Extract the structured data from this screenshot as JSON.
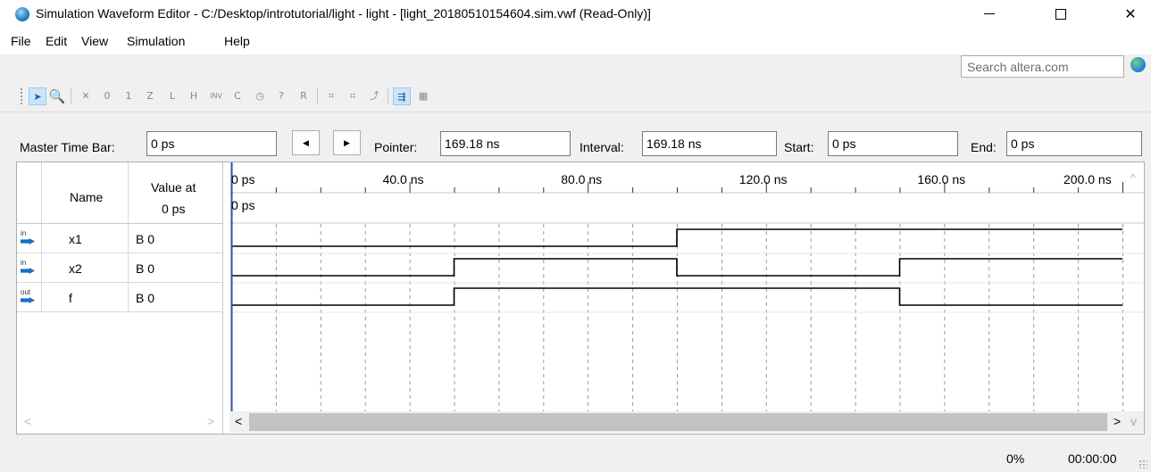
{
  "window": {
    "title": "Simulation Waveform Editor - C:/Desktop/introtutorial/light - light - [light_20180510154604.sim.vwf (Read-Only)]",
    "controls": {
      "minimize": "—",
      "maximize": "☐",
      "close": "✕"
    }
  },
  "menu": [
    "File",
    "Edit",
    "View",
    "Simulation",
    "Help"
  ],
  "search": {
    "placeholder": "Search altera.com"
  },
  "toolbar": {
    "tools": [
      "selection-tool",
      "zoom-tool",
      "forcing-unknown",
      "forcing-low",
      "forcing-high",
      "high-impedance",
      "weak-low",
      "weak-high",
      "invert",
      "count-value",
      "clock",
      "arbitrary-value",
      "random-value",
      "snap-to-grid",
      "grid-settings",
      "overwrite-clock",
      "overwrite-count",
      "snap-transitions",
      "waveform-settings"
    ]
  },
  "timebar": {
    "master_label": "Master Time Bar:",
    "master_value": "0 ps",
    "prev": "◀",
    "next": "▶",
    "pointer_label": "Pointer:",
    "pointer_value": "169.18 ns",
    "interval_label": "Interval:",
    "interval_value": "169.18 ns",
    "start_label": "Start:",
    "start_value": "0 ps",
    "end_label": "End:",
    "end_value": "0 ps"
  },
  "signals": {
    "header_name": "Name",
    "header_value_line1": "Value at",
    "header_value_line2": "0 ps",
    "rows": [
      {
        "type": "in",
        "name": "x1",
        "value": "B 0"
      },
      {
        "type": "in",
        "name": "x2",
        "value": "B 0"
      },
      {
        "type": "out",
        "name": "f",
        "value": "B 0"
      }
    ]
  },
  "ruler": {
    "labels": [
      "0 ps",
      "40.0 ns",
      "80.0 ns",
      "120.0 ns",
      "160.0 ns",
      "200.0 ns"
    ],
    "sub_label": "0 ps"
  },
  "chart_data": {
    "type": "line",
    "xlabel": "",
    "ylabel": "",
    "x_unit": "ns",
    "xlim": [
      0,
      200
    ],
    "series": [
      {
        "name": "x1",
        "x": [
          0,
          100,
          200
        ],
        "values": [
          0,
          1,
          1
        ]
      },
      {
        "name": "x2",
        "x": [
          0,
          50,
          100,
          150,
          200
        ],
        "values": [
          0,
          1,
          0,
          1,
          1
        ]
      },
      {
        "name": "f",
        "x": [
          0,
          50,
          150,
          200
        ],
        "values": [
          0,
          1,
          0,
          0
        ]
      }
    ]
  },
  "scroll": {
    "left": "<",
    "right": ">",
    "up": "^",
    "down": "v"
  },
  "status": {
    "progress": "0%",
    "elapsed": "00:00:00"
  },
  "colors": {
    "cursor": "#3a4ba8",
    "wave": "#000000",
    "grid": "#9a9a9a"
  }
}
